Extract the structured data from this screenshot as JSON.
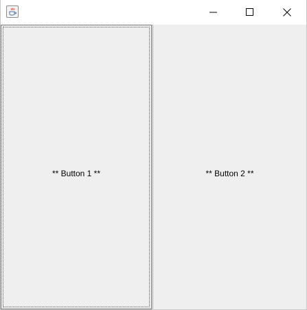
{
  "window": {
    "icon": "java-coffee-cup-icon",
    "controls": {
      "minimize": "minimize-icon",
      "maximize": "maximize-icon",
      "close": "close-icon"
    }
  },
  "buttons": {
    "button1_label": "** Button 1 **",
    "button2_label": "** Button 2 **"
  },
  "colors": {
    "panel_background": "#efefef",
    "titlebar_background": "#ffffff"
  }
}
